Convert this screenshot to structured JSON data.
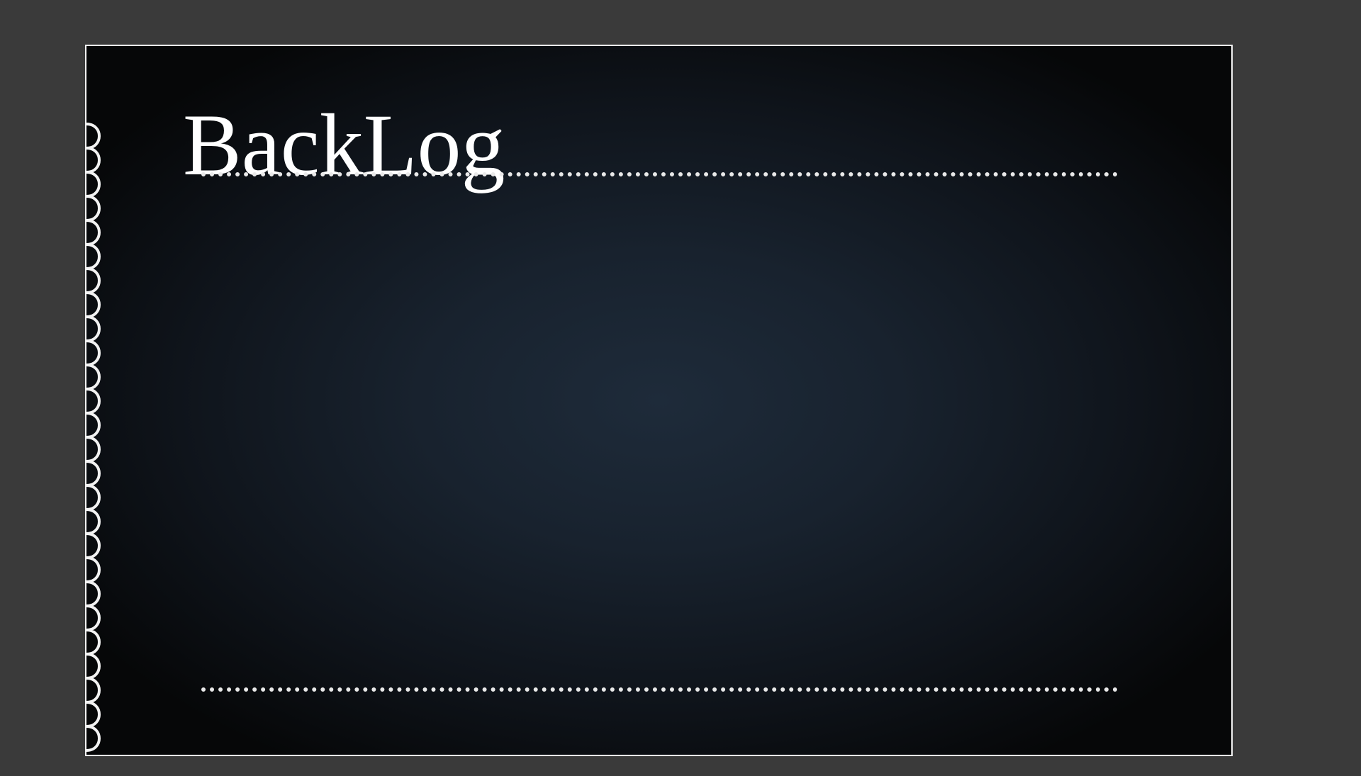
{
  "slide": {
    "title": "BackLog"
  },
  "colors": {
    "workspace_background": "#3a3a3a",
    "slide_center": "#1e2b3a",
    "slide_edge": "#060708",
    "border": "#f2f2f2",
    "text": "#ffffff",
    "dotted_rule": "#e9e9e9"
  },
  "icons": {
    "left_edge": "scalloped-edge-icon",
    "divider": "dotted-line"
  }
}
